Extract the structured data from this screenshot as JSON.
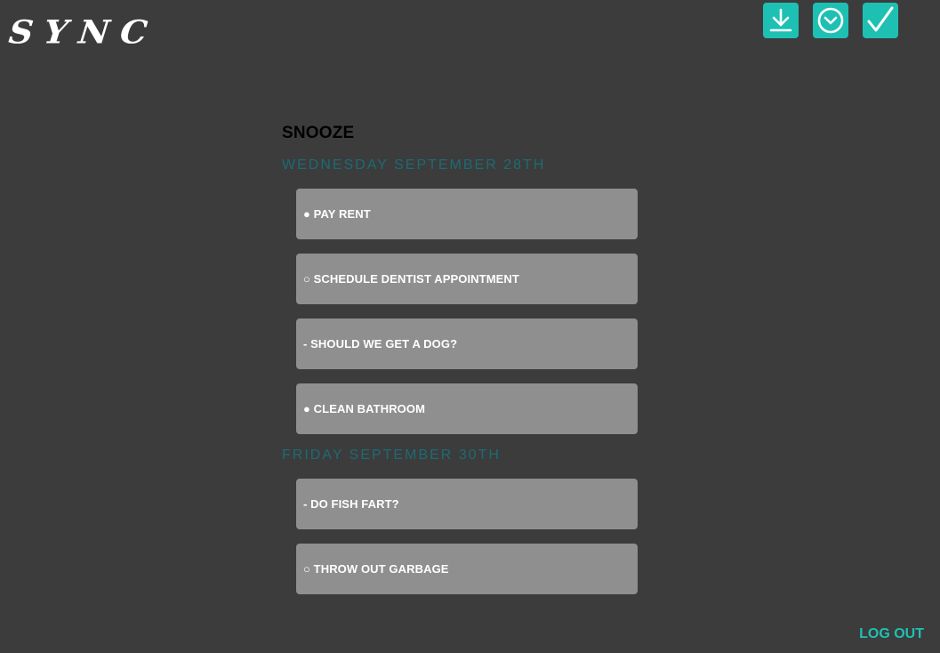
{
  "app": {
    "logo": "SYNC"
  },
  "toolbar": {
    "buttons": [
      {
        "icon": "download-icon"
      },
      {
        "icon": "clock-icon"
      },
      {
        "icon": "checkmark-icon"
      }
    ],
    "accent_color": "#1fc0b4"
  },
  "main": {
    "title": "SNOOZE",
    "days": [
      {
        "heading": "WEDNESDAY SEPTEMBER 28TH",
        "tasks": [
          {
            "text": "● PAY RENT"
          },
          {
            "text": "○ SCHEDULE DENTIST APPOINTMENT"
          },
          {
            "text": "- SHOULD WE GET A DOG?"
          },
          {
            "text": "● CLEAN BATHROOM"
          }
        ]
      },
      {
        "heading": "FRIDAY SEPTEMBER 30TH",
        "tasks": [
          {
            "text": "- DO FISH FART?"
          },
          {
            "text": "○ THROW OUT GARBAGE"
          }
        ]
      }
    ]
  },
  "footer": {
    "logout_label": "LOG OUT"
  },
  "colors": {
    "background": "#3c3c3c",
    "card": "#8f8f8f",
    "day_heading": "#1c6b74",
    "accent": "#1fc0b4"
  }
}
